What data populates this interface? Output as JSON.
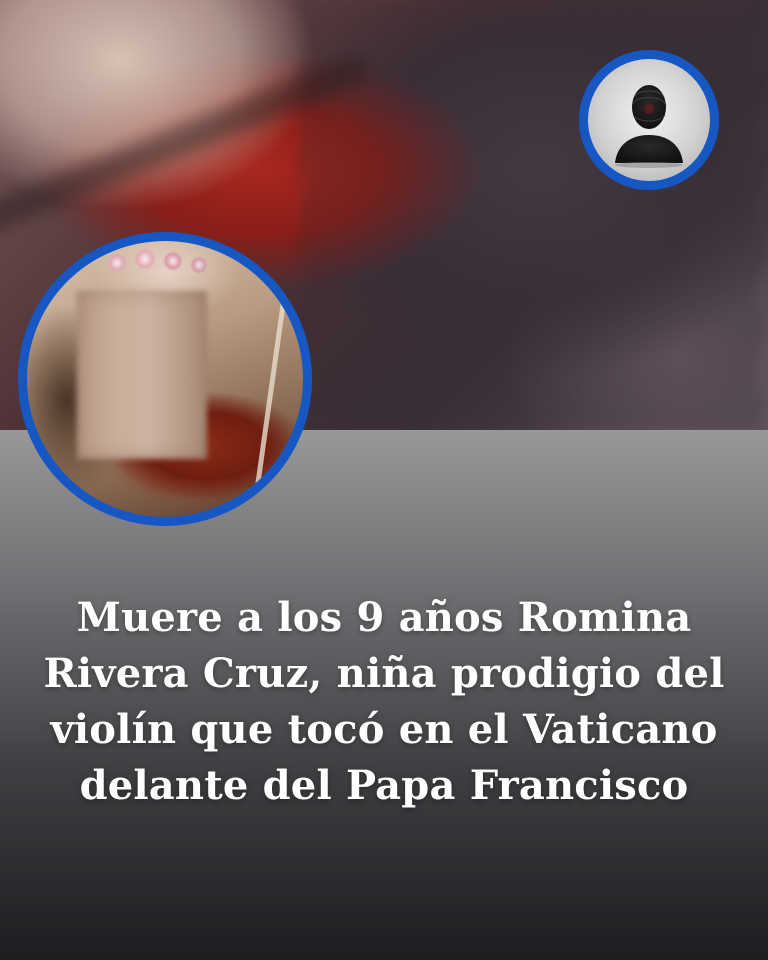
{
  "headline": {
    "lines": [
      "Muere a los 9 años Romina",
      "Rivera Cruz, niña prodigio del",
      "violín que tocó en el Vaticano",
      "delante del Papa Francisco"
    ]
  },
  "colors": {
    "circle_border": "#1657c4",
    "headline_text": "#ffffff",
    "panel_top": "#98989a",
    "panel_bottom": "#1d1d20"
  },
  "icons": {
    "avatar": "anonymous-person-silhouette-icon"
  }
}
